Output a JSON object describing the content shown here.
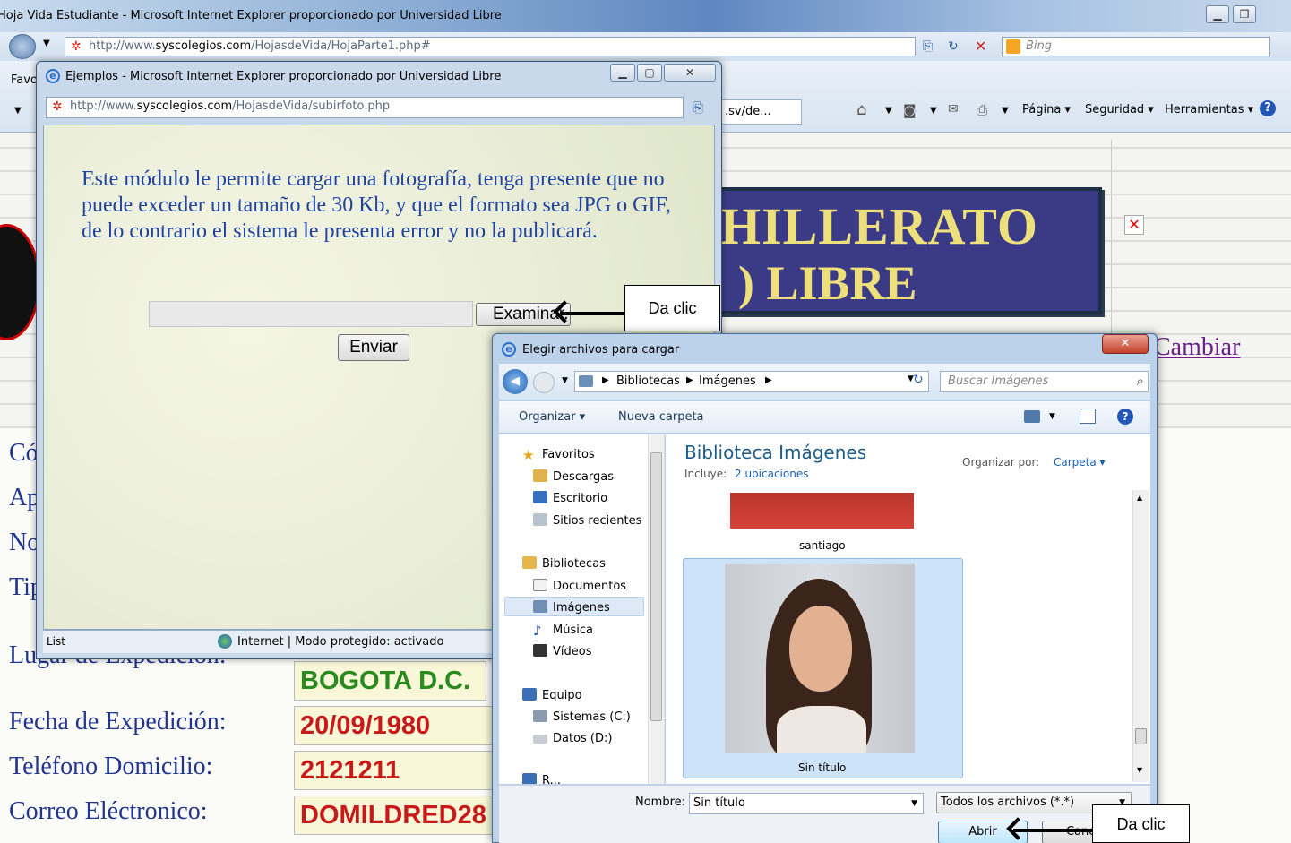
{
  "main_window": {
    "title": "Hoja Vida Estudiante - Microsoft Internet Explorer proporcionado por Universidad Libre",
    "url_prefix": "http://www.",
    "url_domain": "syscolegios.com",
    "url_path": "/HojasdeVida/HojaParte1.php#",
    "search_placeholder": "Bing",
    "favorites_label": "Favo",
    "tab_fragment": ".sv/de...",
    "menu": [
      "Página ▾",
      "Seguridad ▾",
      "Herramientas ▾"
    ]
  },
  "page": {
    "banner_line1": "HILLERATO",
    "banner_line2": ") LIBRE",
    "cambiar_link": "Cambiar",
    "labels": {
      "codigo": "Có",
      "apellidos": "Ap",
      "nombres": "No",
      "tipo": "Tip",
      "lugar": "Lugar de Expedicion:",
      "fecha": "Fecha de Expedición:",
      "telefono": "Teléfono Domicilio:",
      "correo": "Correo Eléctronico:"
    },
    "values": {
      "lugar": "BOGOTA D.C.",
      "fecha": "20/09/1980",
      "telefono": "2121211",
      "correo": "DOMILDRED28"
    }
  },
  "popup": {
    "title": "Ejemplos - Microsoft Internet Explorer proporcionado por Universidad Libre",
    "url_prefix": "http://www.",
    "url_domain": "syscolegios.com",
    "url_path": "/HojasdeVida/subirfoto.php",
    "message": "Este módulo le permite cargar una fotografía, tenga presente que no puede exceder un tamaño de 30 Kb, y que el formato sea JPG o GIF, de lo contrario el sistema le presenta error y no la publicará.",
    "browse_button": "Examinar...",
    "submit_button": "Enviar",
    "status_left": "List",
    "status_zone": "Internet | Modo protegido: activado"
  },
  "callouts": {
    "browse_hint": "Da clic",
    "open_hint": "Da clic"
  },
  "dialog": {
    "title": "Elegir archivos para cargar",
    "breadcrumb": [
      "Bibliotecas",
      "Imágenes"
    ],
    "search_placeholder": "Buscar Imágenes",
    "organize": "Organizar ▾",
    "new_folder": "Nueva carpeta",
    "sidebar": {
      "favorites_header": "Favoritos",
      "favorites": [
        "Descargas",
        "Escritorio",
        "Sitios recientes"
      ],
      "libraries_header": "Bibliotecas",
      "libraries": [
        "Documentos",
        "Imágenes",
        "Música",
        "Vídeos"
      ],
      "computer_header": "Equipo",
      "drives": [
        "Sistemas (C:)",
        "Datos (D:)"
      ],
      "network_partial": "R..."
    },
    "library_title": "Biblioteca Imágenes",
    "includes_label": "Incluye:",
    "includes_link": "2 ubicaciones",
    "arrange_label": "Organizar por:",
    "arrange_value": "Carpeta ▾",
    "files": [
      "santiago",
      "Sin título"
    ],
    "filename_label": "Nombre:",
    "filename_value": "Sin título",
    "filetype": "Todos los archivos (*.*)",
    "open_button": "Abrir",
    "cancel_button": "Canc"
  }
}
